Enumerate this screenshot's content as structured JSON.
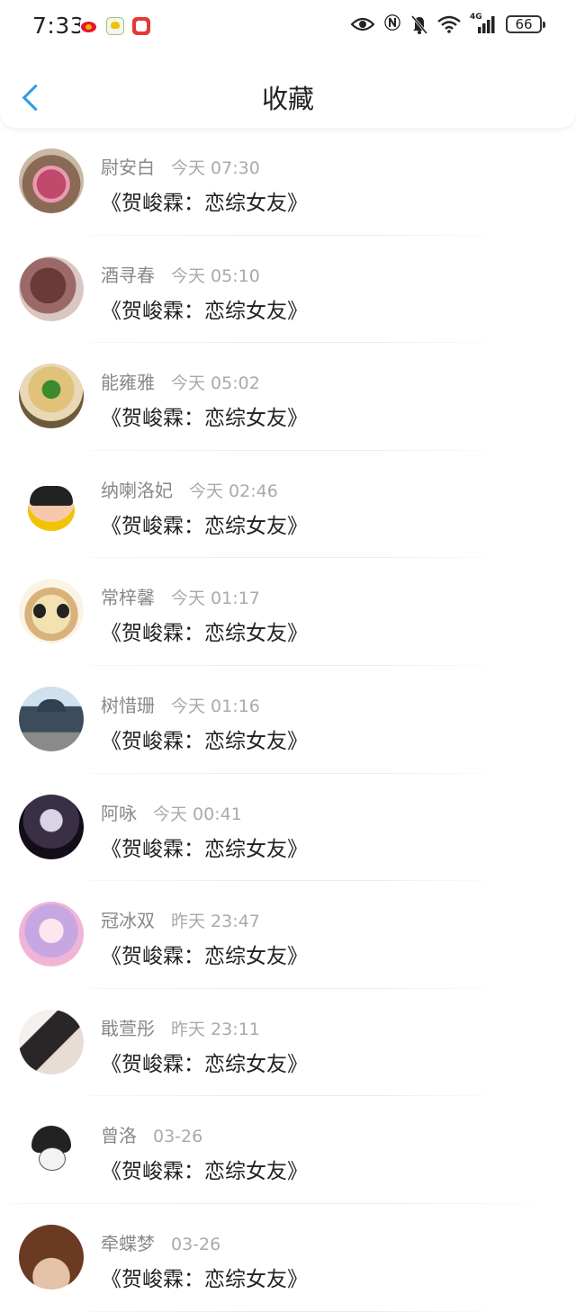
{
  "status_bar": {
    "time": "7:33",
    "network": "4G",
    "battery": "66"
  },
  "header": {
    "title": "收藏"
  },
  "items": [
    {
      "name": "尉安白",
      "time": "今天 07:30",
      "title": "《贺峻霖：恋综女友》"
    },
    {
      "name": "酒寻春",
      "time": "今天 05:10",
      "title": "《贺峻霖：恋综女友》"
    },
    {
      "name": "能雍雅",
      "time": "今天 05:02",
      "title": "《贺峻霖：恋综女友》"
    },
    {
      "name": "纳喇洛妃",
      "time": "今天 02:46",
      "title": "《贺峻霖：恋综女友》"
    },
    {
      "name": "常梓馨",
      "time": "今天 01:17",
      "title": "《贺峻霖：恋综女友》"
    },
    {
      "name": "树惜珊",
      "time": "今天 01:16",
      "title": "《贺峻霖：恋综女友》"
    },
    {
      "name": "阿咏",
      "time": "今天 00:41",
      "title": "《贺峻霖：恋综女友》"
    },
    {
      "name": "冠冰双",
      "time": "昨天 23:47",
      "title": "《贺峻霖：恋综女友》"
    },
    {
      "name": "戢萱彤",
      "time": "昨天 23:11",
      "title": "《贺峻霖：恋综女友》"
    },
    {
      "name": "曾洛",
      "time": "03-26",
      "title": "《贺峻霖：恋综女友》"
    },
    {
      "name": "牵蝶梦",
      "time": "03-26",
      "title": "《贺峻霖：恋综女友》"
    }
  ],
  "colors": {
    "accent": "#2f9ae8",
    "name_text": "#888888",
    "time_text": "#aaaaaa"
  }
}
